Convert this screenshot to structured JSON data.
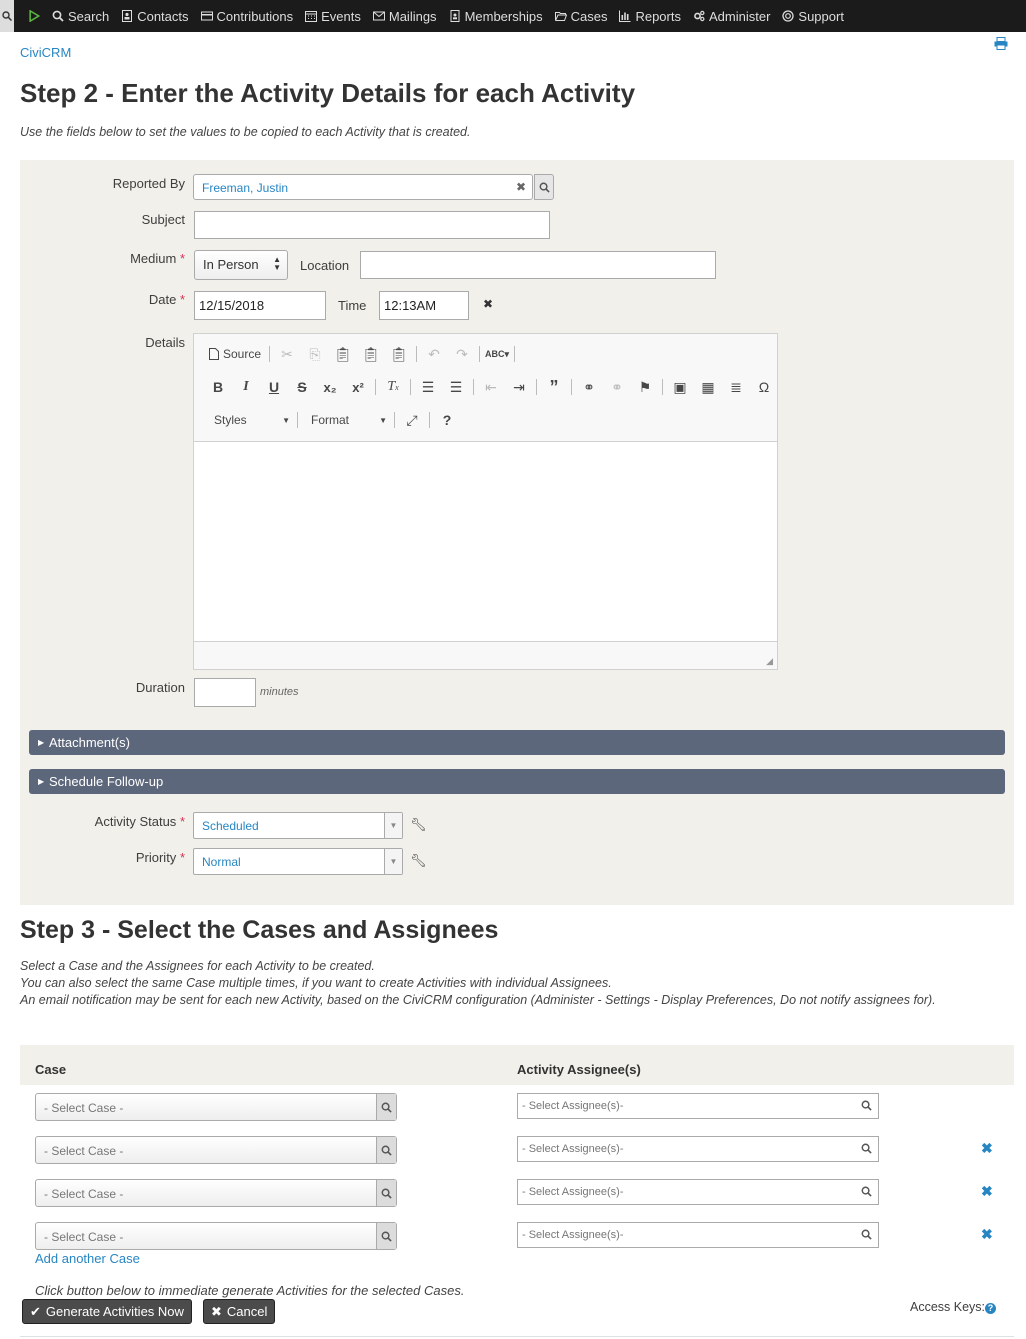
{
  "nav": {
    "items": [
      {
        "label": "Search",
        "icon": "search-icon"
      },
      {
        "label": "Contacts",
        "icon": "contacts-icon"
      },
      {
        "label": "Contributions",
        "icon": "credit-card-icon"
      },
      {
        "label": "Events",
        "icon": "calendar-icon"
      },
      {
        "label": "Mailings",
        "icon": "envelope-icon"
      },
      {
        "label": "Memberships",
        "icon": "id-badge-icon"
      },
      {
        "label": "Cases",
        "icon": "folder-open-icon"
      },
      {
        "label": "Reports",
        "icon": "bar-chart-icon"
      },
      {
        "label": "Administer",
        "icon": "gears-icon"
      },
      {
        "label": "Support",
        "icon": "life-ring-icon"
      }
    ]
  },
  "breadcrumb": "CiviCRM",
  "step2": {
    "title": "Step 2 - Enter the Activity Details for each Activity",
    "help": "Use the fields below to set the values to be copied to each Activity that is created."
  },
  "form": {
    "reported_by_label": "Reported By",
    "reported_by_value": "Freeman, Justin",
    "subject_label": "Subject",
    "subject_value": "",
    "medium_label": "Medium",
    "medium_value": "In Person",
    "location_label": "Location",
    "location_value": "",
    "date_label": "Date",
    "date_value": "12/15/2018",
    "time_label": "Time",
    "time_value": "12:13AM",
    "details_label": "Details",
    "duration_label": "Duration",
    "duration_value": "",
    "duration_unit": "minutes",
    "required_marker": "*"
  },
  "editor": {
    "source_label": "Source",
    "styles_label": "Styles",
    "format_label": "Format"
  },
  "accordions": {
    "attachments": "Attachment(s)",
    "followup": "Schedule Follow-up"
  },
  "status": {
    "label": "Activity Status",
    "value": "Scheduled"
  },
  "priority": {
    "label": "Priority",
    "value": "Normal"
  },
  "step3": {
    "title": "Step 3 - Select the Cases and Assignees",
    "desc1": "Select a Case and the Assignees for each Activity to be created.",
    "desc2": "You can also select the same Case multiple times, if you want to create Activities with individual Assignees.",
    "desc3": "An email notification may be sent for each new Activity, based on the CiviCRM configuration (Administer - Settings - Display Preferences, Do not notify assignees for).",
    "col_case": "Case",
    "col_assignee": "Activity Assignee(s)",
    "rows": [
      {
        "case": "- Select Case -",
        "assignee": "- Select Assignee(s)-"
      },
      {
        "case": "- Select Case -",
        "assignee": "- Select Assignee(s)-"
      },
      {
        "case": "- Select Case -",
        "assignee": "- Select Assignee(s)-"
      },
      {
        "case": "- Select Case -",
        "assignee": "- Select Assignee(s)-"
      }
    ],
    "add_link": "Add another Case",
    "generate_hint": "Click button below to immediate generate Activities for the selected Cases."
  },
  "buttons": {
    "generate": "Generate Activities Now",
    "cancel": "Cancel"
  },
  "access_keys": "Access Keys:",
  "colors": {
    "nav_bg": "#1b1b1b",
    "panel_bg": "#f1f0ea",
    "accent": "#2786c2",
    "accordion": "#5d677b",
    "required": "#cf3458"
  }
}
